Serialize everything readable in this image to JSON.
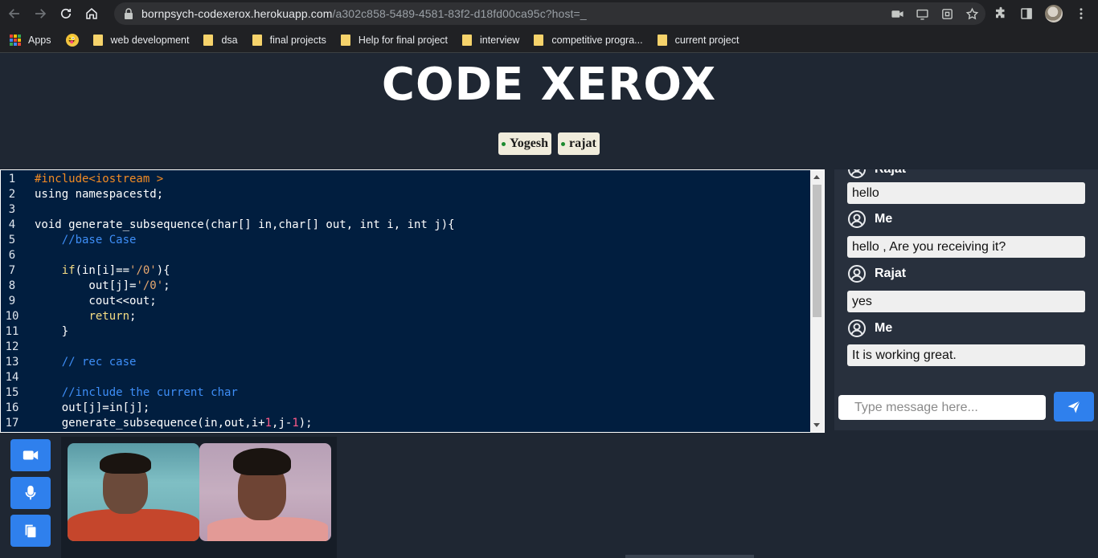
{
  "browser": {
    "url_host": "bornpsych-codexerox.herokuapp.com",
    "url_path": "/a302c858-5489-4581-83f2-d18fd00ca95c?host=_",
    "bookmarks": [
      {
        "label": "Apps",
        "icon": "apps-grid-icon"
      },
      {
        "label": "",
        "icon": "emoji-icon"
      },
      {
        "label": "web development",
        "icon": "folder-icon"
      },
      {
        "label": "dsa",
        "icon": "folder-icon"
      },
      {
        "label": "final projects",
        "icon": "folder-icon"
      },
      {
        "label": "Help for final project",
        "icon": "folder-icon"
      },
      {
        "label": "interview",
        "icon": "folder-icon"
      },
      {
        "label": "competitive progra...",
        "icon": "folder-icon"
      },
      {
        "label": "current project",
        "icon": "folder-icon"
      }
    ]
  },
  "app": {
    "title": "CODE XEROX",
    "users": [
      "Yogesh",
      "rajat"
    ],
    "accent_color": "#2f80ed",
    "online_color": "#1b8a2f"
  },
  "editor": {
    "lines": [
      {
        "n": "1",
        "html": "<span class=\"pr\">#include&lt;iostream &gt;</span>"
      },
      {
        "n": "2",
        "html": "using namespacestd;"
      },
      {
        "n": "3",
        "html": ""
      },
      {
        "n": "4",
        "html": "void generate_subsequence(char[] in,char[] out, int i, int j){"
      },
      {
        "n": "5",
        "html": "    <span class=\"cm\">//base Case</span>"
      },
      {
        "n": "6",
        "html": ""
      },
      {
        "n": "7",
        "html": "    <span class=\"kw\">if</span>(in[i]==<span class=\"st\">'/0'</span>){"
      },
      {
        "n": "8",
        "html": "        out[j]=<span class=\"st\">'/0'</span>;"
      },
      {
        "n": "9",
        "html": "        cout&lt;&lt;out;"
      },
      {
        "n": "10",
        "html": "        <span class=\"rt\">return</span>;"
      },
      {
        "n": "11",
        "html": "    }"
      },
      {
        "n": "12",
        "html": ""
      },
      {
        "n": "13",
        "html": "    <span class=\"cm\">// rec case</span>"
      },
      {
        "n": "14",
        "html": ""
      },
      {
        "n": "15",
        "html": "    <span class=\"cm\">//include the current char</span>"
      },
      {
        "n": "16",
        "html": "    out[j]=in[j];"
      },
      {
        "n": "17",
        "html": "    generate_subsequence(in,out,i+<span class=\"nm\">1</span>,j-<span class=\"nm\">1</span>);"
      }
    ]
  },
  "chat": {
    "messages": [
      {
        "sender": "Rajat",
        "text": "hello"
      },
      {
        "sender": "Me",
        "text": "hello , Are you receiving it?"
      },
      {
        "sender": "Rajat",
        "text": "yes"
      },
      {
        "sender": "Me",
        "text": "It is working great."
      }
    ],
    "input_placeholder": "Type message here..."
  },
  "controls": [
    {
      "name": "video-toggle-button",
      "icon": "video-camera-icon"
    },
    {
      "name": "mic-toggle-button",
      "icon": "microphone-icon"
    },
    {
      "name": "copy-link-button",
      "icon": "copy-icon"
    }
  ]
}
